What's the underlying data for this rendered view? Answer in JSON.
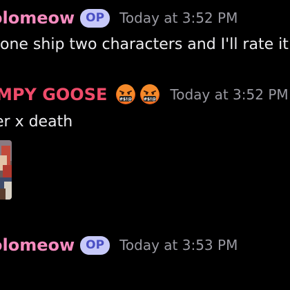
{
  "colors": {
    "background": "#000000",
    "op_username": "#f58bbf",
    "goose_username": "#ef4b6a",
    "op_badge_bg": "#c7c9f9",
    "op_badge_text": "#4a4fc4",
    "timestamp": "#9a9aa2",
    "message_text": "#ececef"
  },
  "messages": [
    {
      "username": "olomeow",
      "badge": "OP",
      "timestamp": "Today at 3:52 PM",
      "text": "one ship two characters and I'll rate it t"
    },
    {
      "username": "MPY GOOSE",
      "badges": [
        "cursing-face-emoji",
        "cursing-face-emoji"
      ],
      "timestamp": "Today at 3:52 PM",
      "text": "er x death",
      "attachment": "image-attachment"
    },
    {
      "username": "olomeow",
      "badge": "OP",
      "timestamp": "Today at 3:53 PM"
    }
  ]
}
